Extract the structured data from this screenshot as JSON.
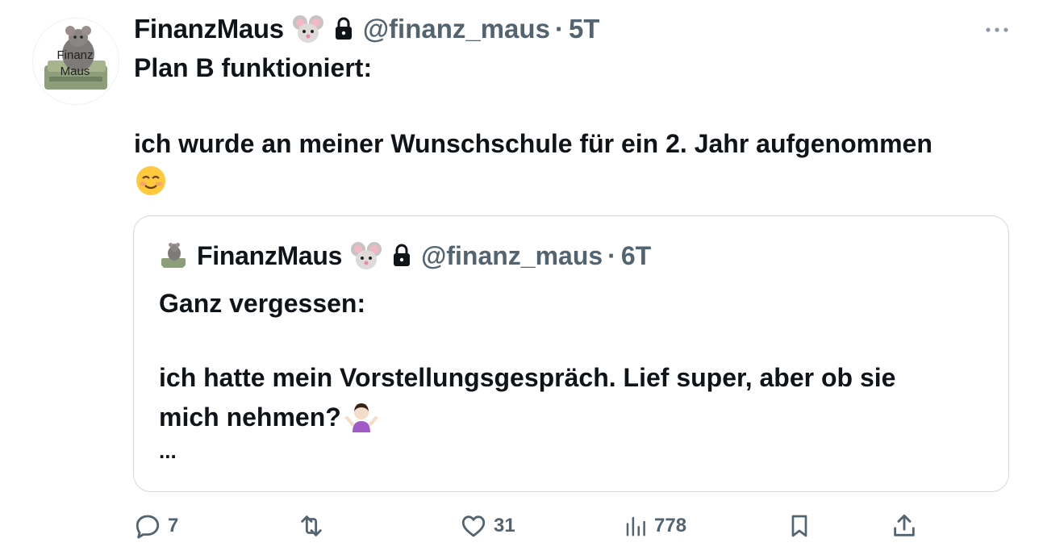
{
  "tweet": {
    "display_name": "FinanzMaus",
    "handle": "@finanz_maus",
    "separator": "·",
    "time": "5T",
    "avatar_text_line1": "Finanz",
    "avatar_text_line2": "Maus",
    "text_lines": [
      "Plan B funktioniert:",
      "ich wurde an meiner Wunschschule für ein 2. Jahr aufgenommen"
    ],
    "trailing_emoji": "smiling-face-emoji"
  },
  "quoted_tweet": {
    "display_name": "FinanzMaus",
    "handle": "@finanz_maus",
    "separator": "·",
    "time": "6T",
    "text_lines": [
      "Ganz vergessen:",
      "ich hatte mein Vorstellungsgespräch. Lief super, aber ob sie",
      "mich nehmen?",
      "..."
    ],
    "trailing_emoji": "shrugging-woman-emoji"
  },
  "actions": {
    "replies": "7",
    "reposts": "",
    "likes": "31",
    "views": "778"
  },
  "colors": {
    "text": "#0f1419",
    "secondary": "#536471",
    "border": "#cfd9de"
  },
  "icons": [
    "mouse-emoji",
    "lock-icon",
    "more-icon",
    "reply-icon",
    "repost-icon",
    "like-icon",
    "views-icon",
    "bookmark-icon",
    "share-icon"
  ]
}
